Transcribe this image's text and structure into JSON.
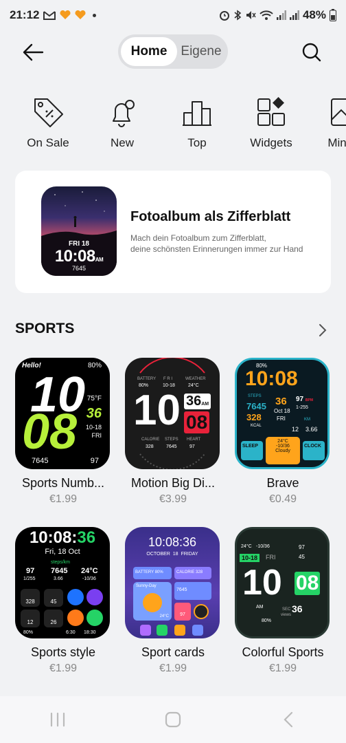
{
  "status": {
    "time": "21:12",
    "battery": "48%"
  },
  "header": {
    "tabs": [
      {
        "label": "Home",
        "active": true
      },
      {
        "label": "Eigene",
        "active": false
      }
    ]
  },
  "categories": [
    {
      "label": "On Sale",
      "icon": "tag-percent-icon"
    },
    {
      "label": "New",
      "icon": "bell-new-icon"
    },
    {
      "label": "Top",
      "icon": "bar-chart-icon"
    },
    {
      "label": "Widgets",
      "icon": "widgets-grid-icon"
    },
    {
      "label": "Minim",
      "icon": "image-icon"
    }
  ],
  "banner": {
    "title": "Fotoalbum als Zifferblatt",
    "subtitle_line1": "Mach dein Fotoalbum zum Zifferblatt,",
    "subtitle_line2": "deine schönsten Erinnerungen immer zur Hand",
    "watch": {
      "date": "FRI 18",
      "time": "10:08",
      "ampm": "AM",
      "steps": "7645"
    }
  },
  "section": {
    "title": "SPORTS"
  },
  "watchfaces": [
    {
      "name": "Sports Numb...",
      "price": "€1.99",
      "face": {
        "hello": "Hello!",
        "battery": "80%",
        "hour": "10",
        "minute": "08",
        "temp": "75°F",
        "day": "36",
        "date": "10-18",
        "weekday": "FRI",
        "steps": "7645",
        "heart": "97"
      }
    },
    {
      "name": "Motion Big Di...",
      "price": "€3.99",
      "face": {
        "battery_label": "BATTERY",
        "battery": "80%",
        "day_label": "F R I",
        "date": "10-18",
        "weather_label": "WEATHER",
        "temp": "24°C",
        "hour": "10",
        "sec": "36",
        "ampm": "AM",
        "minute": "08",
        "calorie_label": "CALORIE",
        "calorie": "328",
        "steps_label": "STEPS",
        "steps": "7645",
        "heart_label": "HEART",
        "heart": "97"
      }
    },
    {
      "name": "Brave",
      "price": "€0.49",
      "face": {
        "battery": "80%",
        "time": "10:08",
        "steps_label": "STEPS",
        "steps": "7645",
        "day": "36",
        "kcal": "328",
        "kcal_label": "KCAL",
        "date": "Oct 18",
        "weekday": "FRI",
        "heart": "97",
        "bpm": "BPM",
        "range": "1-255",
        "km_label": "KM",
        "v1": "12",
        "v2": "3.66",
        "sleep": "SLEEP",
        "weather_temp": "24°C",
        "weather_range": "-10/36",
        "cloudy": "Cloudy",
        "clock": "CLOCK"
      }
    },
    {
      "name": "Sports style",
      "price": "€1.99",
      "face": {
        "h": "10",
        "m": "08",
        "s": "36",
        "date": "Fri, 18 Oct",
        "heart": "97",
        "range": "1/255",
        "steps_label": "steps/km",
        "steps": "7645",
        "km": "3.66",
        "temp": "24°C",
        "trange": "-10/36",
        "c1": "328",
        "c2": "45",
        "c3": "12",
        "c4": "26",
        "battery": "80%",
        "t1": "6:30",
        "t2": "18:30"
      }
    },
    {
      "name": "Sport cards",
      "price": "€1.99",
      "face": {
        "time": "10:08:36",
        "month": "OCTOBER",
        "day": "18",
        "weekday": "FRIDAY",
        "battery_label": "BATTERY",
        "battery": "80%",
        "calorie_label": "CALORIE",
        "calorie": "328",
        "weather": "Sunny-Day",
        "steps": "7645",
        "temp": "24°C",
        "heart": "97"
      }
    },
    {
      "name": "Colorful Sports",
      "price": "€1.99",
      "face": {
        "temp": "24°C",
        "trange": "-10/36",
        "date": "10-18",
        "weekday": "FRI",
        "v1": "97",
        "v2": "45",
        "hour": "10",
        "minute": "08",
        "ampm": "AM",
        "sec": "36",
        "sec_label": "SEC",
        "battery": "80%",
        "views": "views"
      }
    }
  ],
  "colors": {
    "background": "#f1f2f4",
    "accent_lime": "#b7f03a",
    "accent_red": "#e8223a",
    "accent_green": "#25d366",
    "accent_orange": "#ffa41b"
  }
}
